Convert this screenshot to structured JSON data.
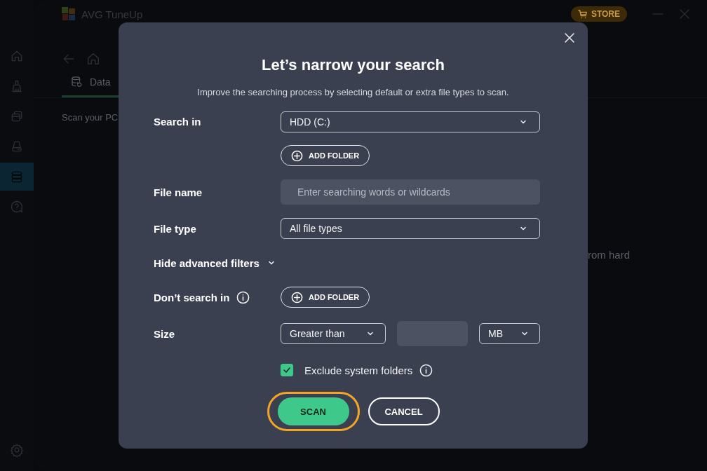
{
  "app": {
    "title": "AVG TuneUp",
    "store_button": "STORE",
    "sidebar": [
      {
        "kind": "home",
        "selected": false
      },
      {
        "kind": "broom",
        "selected": false
      },
      {
        "kind": "windows",
        "selected": false
      },
      {
        "kind": "drive",
        "selected": false
      },
      {
        "kind": "database",
        "selected": true
      },
      {
        "kind": "help",
        "selected": false
      }
    ],
    "tab": {
      "label": "Data",
      "selected": true
    },
    "intro_text": "Scan your PC",
    "body_fragment": "rom hard"
  },
  "dialog": {
    "title": "Let’s narrow your search",
    "subtitle": "Improve the searching process by selecting default or extra file types to scan.",
    "search_in": {
      "label": "Search in",
      "value": "HDD (C:)",
      "add_folder": "ADD FOLDER"
    },
    "file_name": {
      "label": "File name",
      "placeholder": "Enter searching words or wildcards"
    },
    "file_type": {
      "label": "File type",
      "value": "All file types"
    },
    "advanced_toggle": {
      "label": "Hide advanced filters",
      "expanded": true
    },
    "dont_search_in": {
      "label": "Don’t search in",
      "add_folder": "ADD FOLDER"
    },
    "size": {
      "label": "Size",
      "comparison": "Greater than",
      "unit": "MB"
    },
    "exclude_system": {
      "label": "Exclude system folders",
      "checked": true
    },
    "buttons": [
      {
        "kind": "primary",
        "label": "SCAN",
        "highlighted": true
      },
      {
        "kind": "secondary",
        "label": "CANCEL",
        "highlighted": false
      }
    ]
  }
}
